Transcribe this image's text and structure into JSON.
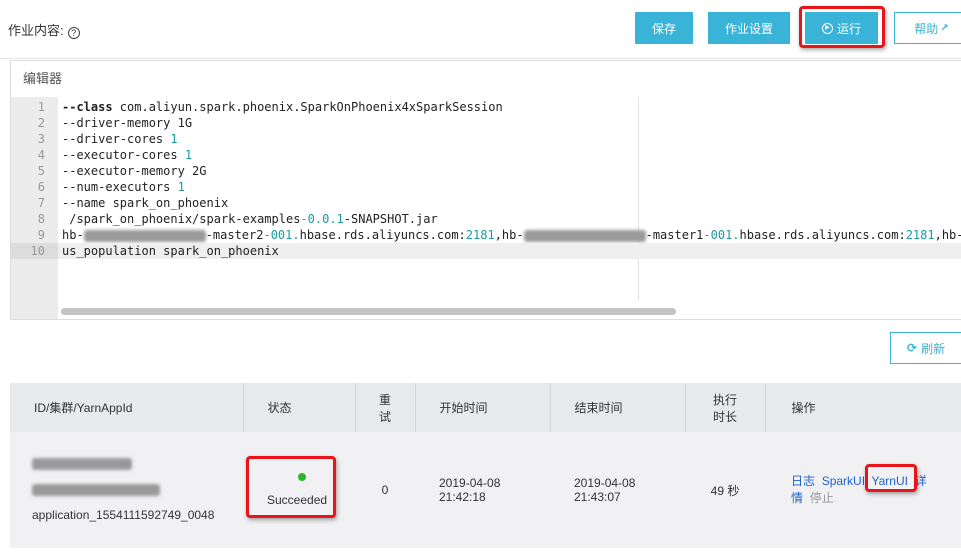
{
  "header": {
    "title": "作业内容:",
    "help_icon": "question-circle-icon",
    "buttons": {
      "save": "保存",
      "settings": "作业设置",
      "run": "运行",
      "help": "帮助"
    }
  },
  "editor": {
    "title": "编辑器",
    "lines": [
      {
        "num": "1",
        "segs": [
          {
            "t": "--class",
            "c": "kw"
          },
          {
            "t": " com.aliyun.spark.phoenix.SparkOnPhoenix4xSparkSession"
          }
        ]
      },
      {
        "num": "2",
        "segs": [
          {
            "t": "--driver-memory 1G"
          }
        ]
      },
      {
        "num": "3",
        "segs": [
          {
            "t": "--driver-cores "
          },
          {
            "t": "1",
            "c": "n"
          }
        ]
      },
      {
        "num": "4",
        "segs": [
          {
            "t": "--executor-cores "
          },
          {
            "t": "1",
            "c": "n"
          }
        ]
      },
      {
        "num": "5",
        "segs": [
          {
            "t": "--executor-memory 2G"
          }
        ]
      },
      {
        "num": "6",
        "segs": [
          {
            "t": "--num-executors "
          },
          {
            "t": "1",
            "c": "n"
          }
        ]
      },
      {
        "num": "7",
        "segs": [
          {
            "t": "--name spark_on_phoenix"
          }
        ]
      },
      {
        "num": "8",
        "segs": [
          {
            "t": " /spark_on_phoenix/spark-examples"
          },
          {
            "t": "-0.0.1",
            "c": "n"
          },
          {
            "t": "-SNAPSHOT.jar"
          }
        ]
      },
      {
        "num": "9",
        "segs": [
          {
            "t": "hb-"
          },
          {
            "t": "",
            "c": "blur",
            "w": 122
          },
          {
            "t": "-master2"
          },
          {
            "t": "-001.",
            "c": "n"
          },
          {
            "t": "hbase.rds.aliyuncs.com:"
          },
          {
            "t": "2181",
            "c": "n"
          },
          {
            "t": ",hb-"
          },
          {
            "t": "",
            "c": "blur",
            "w": 122
          },
          {
            "t": "-master1"
          },
          {
            "t": "-001.",
            "c": "n"
          },
          {
            "t": "hbase.rds.aliyuncs.com:"
          },
          {
            "t": "2181",
            "c": "n"
          },
          {
            "t": ",hb-"
          }
        ]
      },
      {
        "num": "10",
        "segs": [
          {
            "t": "us_population spark_on_phoenix"
          }
        ]
      }
    ]
  },
  "refresh_label": "刷新",
  "table": {
    "headers": [
      "ID/集群/YarnAppId",
      "状态",
      "重试",
      "开始时间",
      "结束时间",
      "执行时长",
      "操作"
    ],
    "rows": [
      {
        "app_id": "application_1554111592749_0048",
        "status": "Succeeded",
        "status_color": "#2db52d",
        "retries": "0",
        "start": "2019-04-08 21:42:18",
        "end": "2019-04-08 21:43:07",
        "duration": "49 秒",
        "actions": [
          "日志",
          "SparkUI",
          "YarnUI",
          "详情",
          "停止"
        ]
      }
    ]
  }
}
